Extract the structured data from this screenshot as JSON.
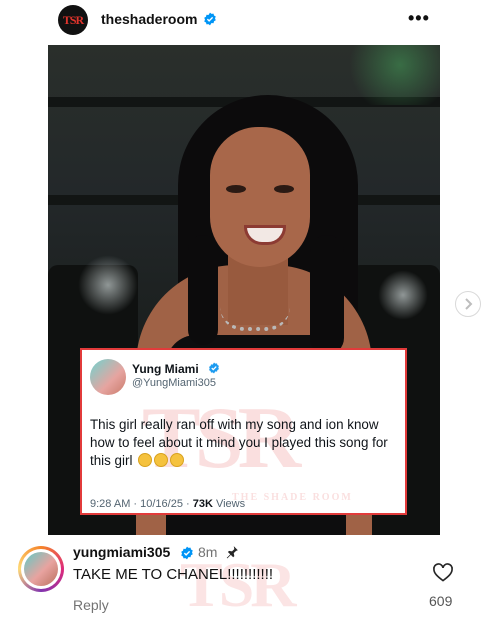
{
  "post": {
    "username": "theshaderoom",
    "avatar_logo": "TSR",
    "more_label": "•••",
    "icons": {
      "verified": "verified-badge-icon",
      "more": "more-options-icon",
      "next": "chevron-right-icon"
    }
  },
  "tweet": {
    "name": "Yung Miami",
    "handle": "@YungMiami305",
    "text": "This girl really ran off with my song and ion know how to feel about it mind you I played this song for this girl",
    "emojis": [
      "thinking-emoji",
      "thinking-emoji",
      "thinking-emoji"
    ],
    "time": "9:28 AM · 10/16/25 · ",
    "views_count": "73K",
    "views_label": " Views",
    "watermark": "TSR",
    "watermark_sub": "THE SHADE ROOM"
  },
  "comment": {
    "username": "yungmiami305",
    "time": "8m",
    "text": "TAKE ME TO CHANEL!!!!!!!!!!!",
    "reply_label": "Reply",
    "likes": "609",
    "icons": {
      "verified": "verified-badge-icon",
      "pin": "pin-icon",
      "like": "heart-icon"
    }
  },
  "colors": {
    "accent": "#0095f6",
    "tsr_red": "#e23b3b"
  }
}
